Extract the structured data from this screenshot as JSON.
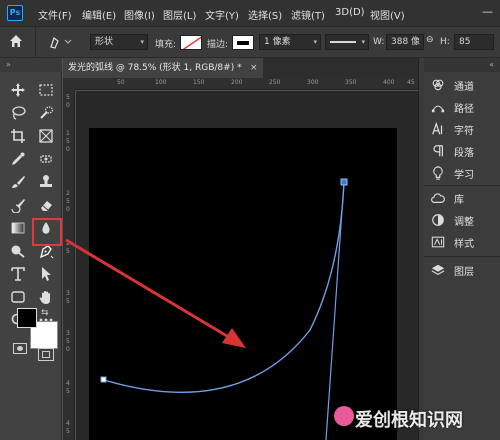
{
  "app": {
    "logo": "Ps"
  },
  "menu": [
    "文件(F)",
    "编辑(E)",
    "图像(I)",
    "图层(L)",
    "文字(Y)",
    "选择(S)",
    "滤镜(T)",
    "3D(D)",
    "视图(V)"
  ],
  "window": {
    "minimize": "—"
  },
  "options_bar": {
    "mode": "形状",
    "fill_label": "填充:",
    "stroke_label": "描边:",
    "stroke_width": "1 像素",
    "width_label": "W:",
    "width_value": "388 像",
    "height_label": "H:",
    "height_value": "85"
  },
  "document": {
    "tab_title": "发光的弧线 @ 78.5% (形状 1, RGB/8#) *",
    "close": "×"
  },
  "ruler_top": [
    "50",
    "100",
    "150",
    "200",
    "250",
    "300",
    "350",
    "400",
    "45"
  ],
  "ruler_left": [
    "5",
    "0",
    "1",
    "5",
    "0",
    "2",
    "5",
    "0",
    "2",
    "5",
    "3",
    "5",
    "3",
    "5",
    "0",
    "4",
    "5",
    "4",
    "5"
  ],
  "panels": [
    {
      "icon": "channels-icon",
      "label": "通道"
    },
    {
      "icon": "paths-icon",
      "label": "路径"
    },
    {
      "icon": "character-icon",
      "label": "字符"
    },
    {
      "icon": "paragraph-icon",
      "label": "段落"
    },
    {
      "icon": "learn-icon",
      "label": "学习"
    },
    {
      "icon": "libraries-icon",
      "label": "库"
    },
    {
      "icon": "adjustments-icon",
      "label": "调整"
    },
    {
      "icon": "styles-icon",
      "label": "样式"
    },
    {
      "icon": "layers-icon",
      "label": "图层"
    }
  ],
  "watermark": "爱创根知识网",
  "colors": {
    "highlight": "#e23a3a",
    "path": "#6fa0e6",
    "arrow": "#d93434",
    "canvas": "#000000"
  }
}
